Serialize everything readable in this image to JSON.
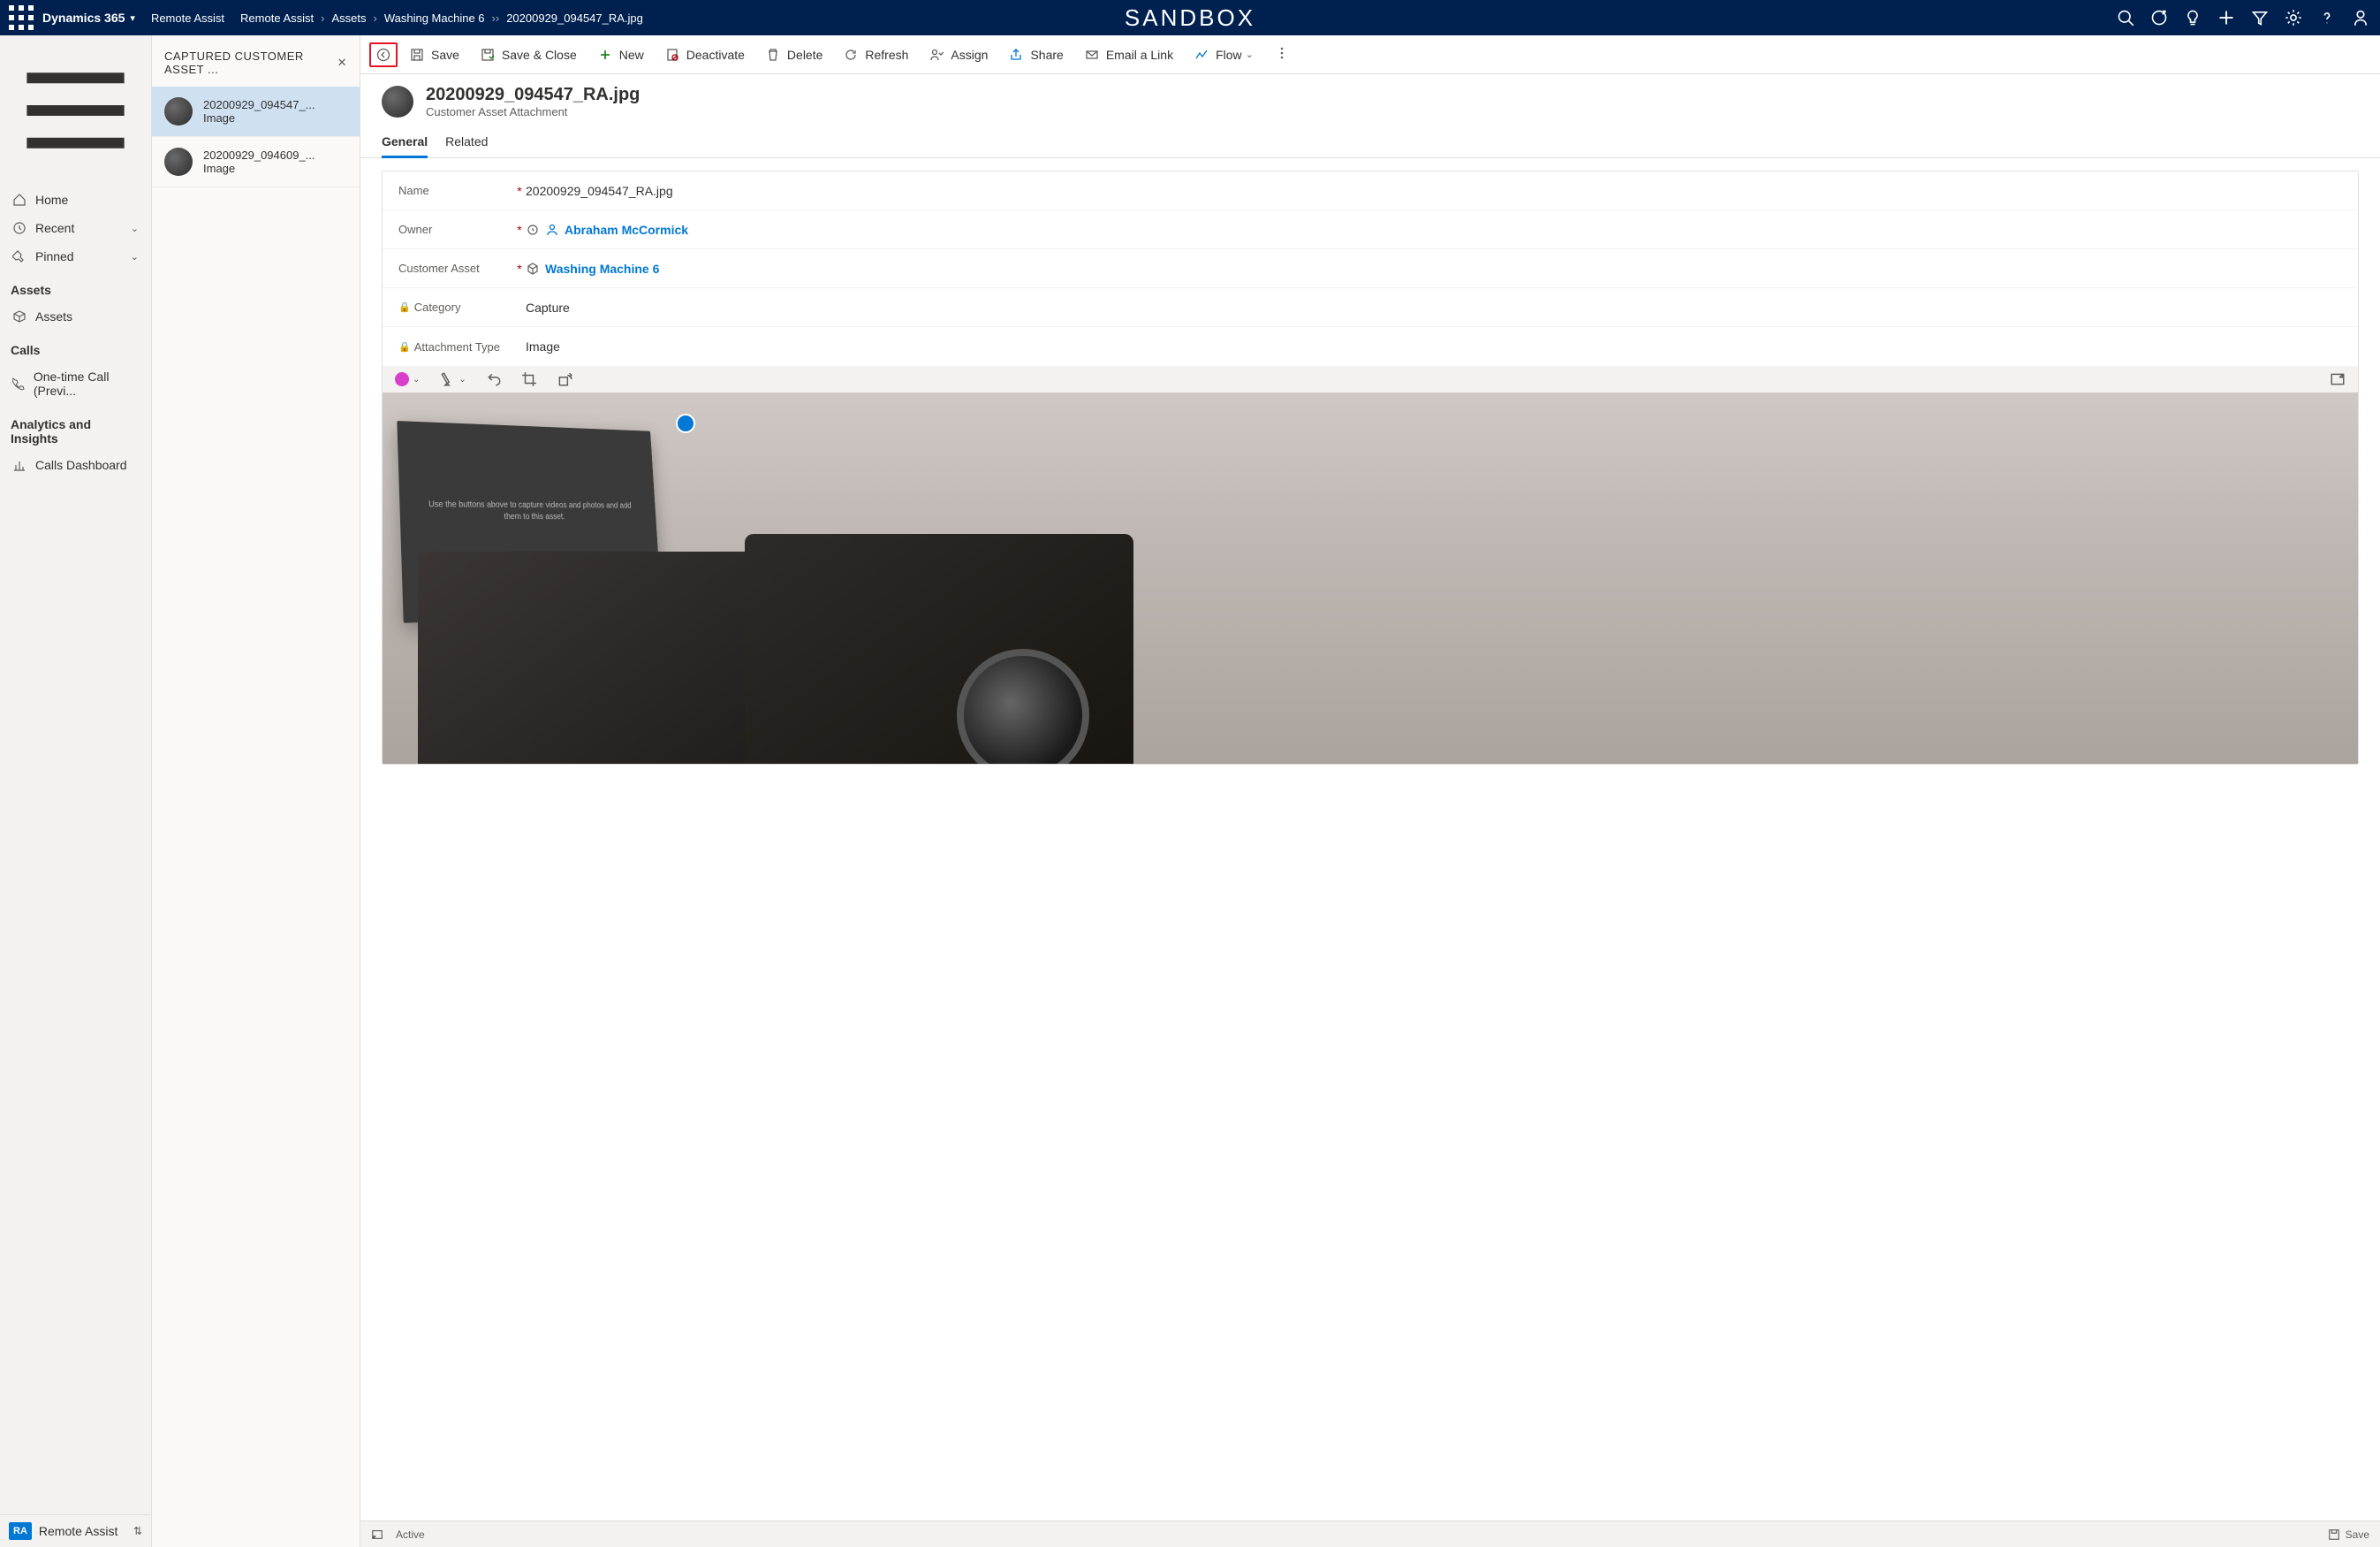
{
  "brand": "Dynamics 365",
  "sandbox": "SANDBOX",
  "breadcrumbs": {
    "app": "Remote Assist",
    "l1": "Remote Assist",
    "l2": "Assets",
    "l3": "Washing Machine 6",
    "l4": "20200929_094547_RA.jpg"
  },
  "nav": {
    "home": "Home",
    "recent": "Recent",
    "pinned": "Pinned",
    "assets_head": "Assets",
    "assets_item": "Assets",
    "calls_head": "Calls",
    "calls_item": "One-time Call (Previ...",
    "analytics_head": "Analytics and Insights",
    "analytics_item": "Calls Dashboard",
    "footer_badge": "RA",
    "footer_label": "Remote Assist"
  },
  "listpanel": {
    "title": "CAPTURED CUSTOMER ASSET ...",
    "items": [
      {
        "title": "20200929_094547_...",
        "sub": "Image"
      },
      {
        "title": "20200929_094609_...",
        "sub": "Image"
      }
    ]
  },
  "cmdbar": {
    "save": "Save",
    "save_close": "Save & Close",
    "new": "New",
    "deactivate": "Deactivate",
    "delete": "Delete",
    "refresh": "Refresh",
    "assign": "Assign",
    "share": "Share",
    "email": "Email a Link",
    "flow": "Flow"
  },
  "record": {
    "title": "20200929_094547_RA.jpg",
    "subtitle": "Customer Asset Attachment"
  },
  "tabs": {
    "general": "General",
    "related": "Related"
  },
  "form": {
    "name_label": "Name",
    "name_value": "20200929_094547_RA.jpg",
    "owner_label": "Owner",
    "owner_value": "Abraham McCormick",
    "asset_label": "Customer Asset",
    "asset_value": "Washing Machine 6",
    "category_label": "Category",
    "category_value": "Capture",
    "attach_label": "Attachment Type",
    "attach_value": "Image"
  },
  "overlay_text": "Use the buttons above to capture videos and photos and add them to this asset.",
  "statusbar": {
    "status": "Active",
    "save": "Save"
  }
}
